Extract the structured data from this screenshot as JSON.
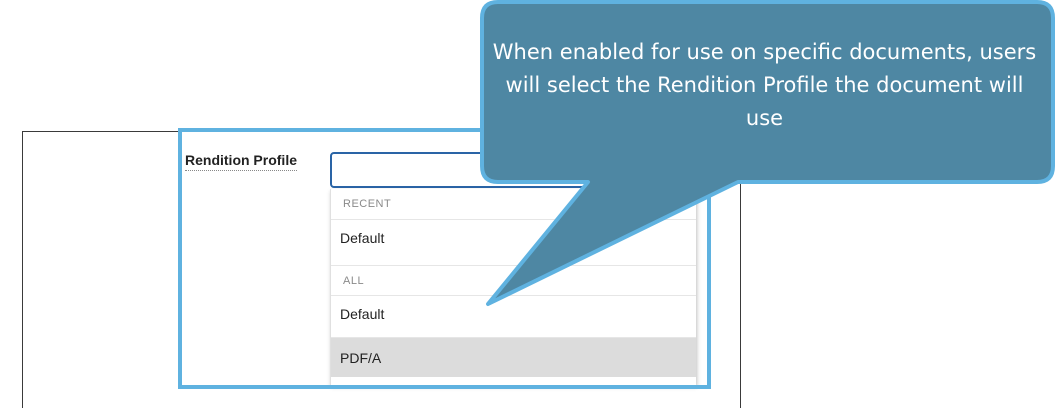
{
  "field": {
    "label": "Rendition Profile",
    "value": ""
  },
  "dropdown": {
    "recent_header": "RECENT",
    "recent_items": [
      "Default"
    ],
    "all_header": "ALL",
    "all_items": [
      "Default",
      "PDF/A"
    ],
    "selected": "PDF/A"
  },
  "callout": {
    "text": "When enabled for use on specific documents, users will select the Rendition Profile the document will use",
    "fill_color": "#4e87a3",
    "border_color": "#5fb2e0"
  },
  "colors": {
    "highlight_border": "#5fb2e0",
    "input_border": "#2a64a6",
    "selected_row": "#dcdcdc"
  }
}
